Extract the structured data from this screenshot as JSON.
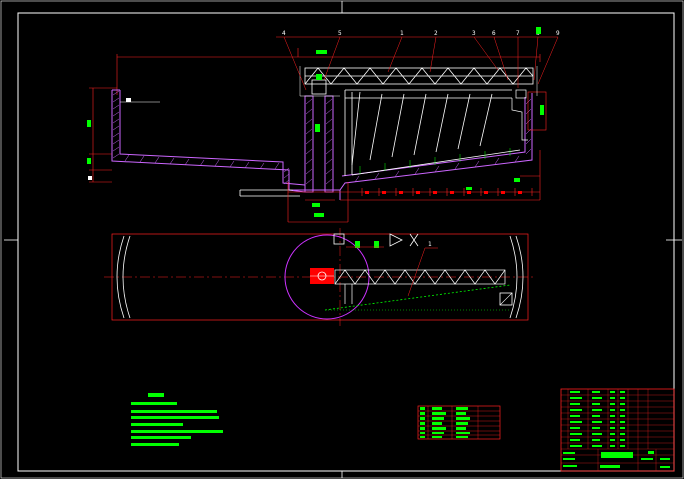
{
  "drawing": {
    "part_numbers": [
      "4",
      "5",
      "1",
      "2",
      "3",
      "6",
      "7",
      "8",
      "9"
    ],
    "plan_part_label": "1"
  },
  "colors": {
    "background": "#000000",
    "frame": "#ffffff",
    "structure": "#ffffff",
    "dimension": "#ff2020",
    "annotation": "#00ff00",
    "concrete_hatch": "#cc66ff",
    "center_drive": "#ff0000"
  },
  "icons": [
    "center-mark-icon",
    "section-arrow-icon",
    "cross-mark-icon"
  ]
}
